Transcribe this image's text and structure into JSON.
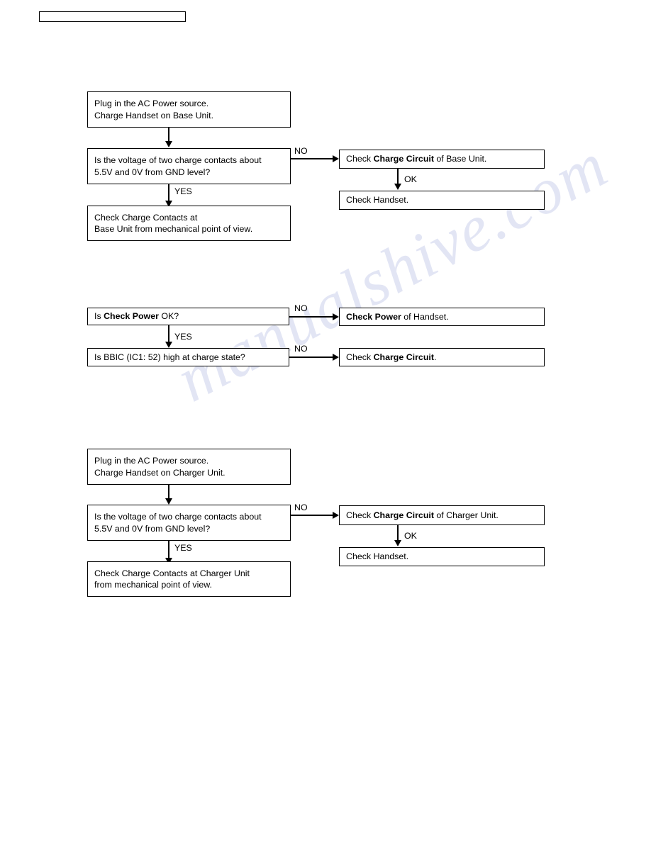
{
  "document": {
    "type": "service-manual-troubleshooting-flowchart",
    "header_box_text": ""
  },
  "watermark": {
    "line1": "manualshive.com"
  },
  "labels": {
    "no": "NO",
    "yes": "YES",
    "ok": "OK"
  },
  "sections": [
    {
      "id": "base-unit-charge",
      "boxes": {
        "start": {
          "line1": "Plug in the AC Power source.",
          "line2": "Charge Handset on Base Unit."
        },
        "decision": {
          "line1": "Is the voltage of two charge contacts about",
          "line2": "5.5V and 0V from GND level?"
        },
        "yes_result": {
          "line1": "Check Charge Contacts at",
          "line2": "Base Unit from mechanical point of view."
        },
        "no_result": {
          "prefix": "Check ",
          "bold": "Charge Circuit",
          "suffix": " of Base Unit."
        },
        "ok_result": {
          "text": "Check Handset."
        }
      }
    },
    {
      "id": "handset-power-bbic",
      "boxes": {
        "decision1": {
          "prefix": "Is ",
          "bold": "Check Power",
          "suffix": " OK?"
        },
        "decision1_no_result": {
          "prefix": "",
          "bold": "Check Power",
          "suffix": " of Handset."
        },
        "decision2": {
          "text": "Is BBIC (IC1: 52) high at charge state?"
        },
        "decision2_no_result": {
          "prefix": "Check ",
          "bold": "Charge Circuit",
          "suffix": "."
        }
      }
    },
    {
      "id": "charger-unit-charge",
      "boxes": {
        "start": {
          "line1": "Plug in the AC Power source.",
          "line2": "Charge Handset on Charger Unit."
        },
        "decision": {
          "line1": "Is the voltage of two charge contacts about",
          "line2": "5.5V and 0V from GND level?"
        },
        "yes_result": {
          "line1": "Check Charge Contacts at Charger Unit",
          "line2": "from mechanical point of view."
        },
        "no_result": {
          "prefix": "Check ",
          "bold": "Charge Circuit",
          "suffix": " of Charger Unit."
        },
        "ok_result": {
          "text": "Check Handset."
        }
      }
    }
  ]
}
